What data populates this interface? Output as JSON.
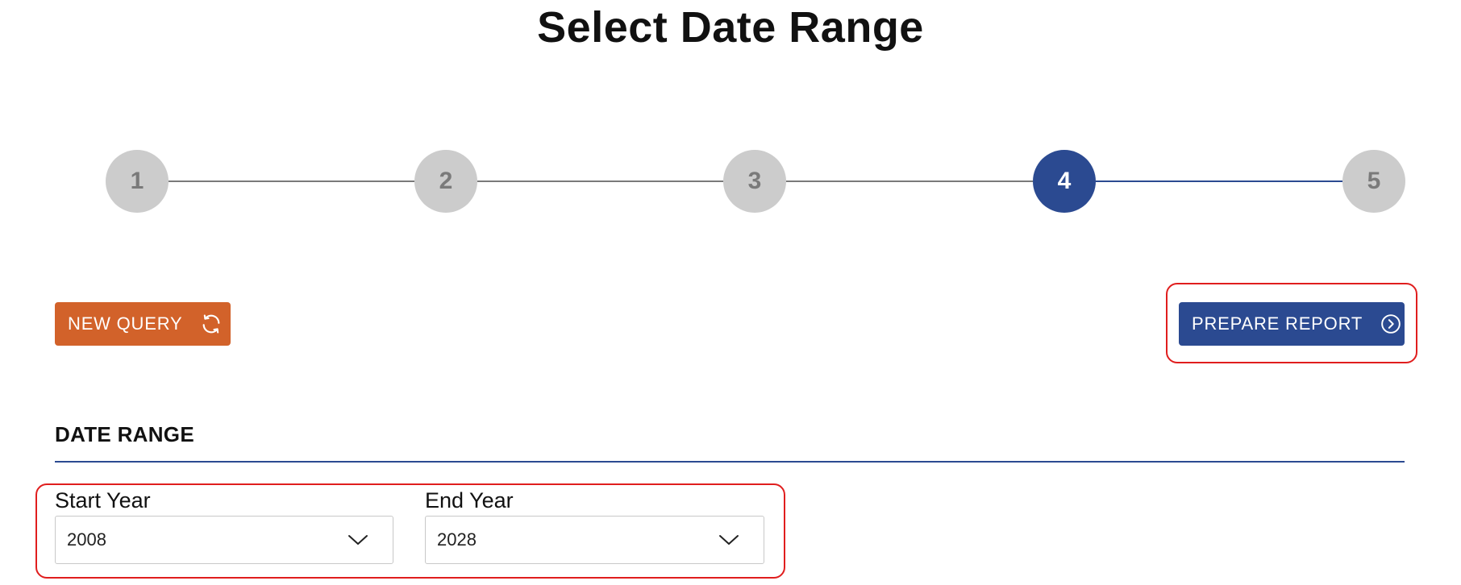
{
  "page": {
    "title": "Select Date Range"
  },
  "stepper": {
    "steps": [
      {
        "label": "1",
        "active": false
      },
      {
        "label": "2",
        "active": false
      },
      {
        "label": "3",
        "active": false
      },
      {
        "label": "4",
        "active": true
      },
      {
        "label": "5",
        "active": false
      }
    ]
  },
  "actions": {
    "new_query_label": "NEW QUERY",
    "new_query_icon": "refresh-icon",
    "prepare_report_label": "PREPARE REPORT",
    "prepare_report_icon": "chevron-right-circle-icon"
  },
  "date_range": {
    "section_title": "DATE RANGE",
    "start_year": {
      "label": "Start Year",
      "value": "2008"
    },
    "end_year": {
      "label": "End Year",
      "value": "2028"
    }
  },
  "colors": {
    "primary": "#2b4a91",
    "accent": "#d2622a",
    "step_inactive": "#cccccc",
    "highlight": "#e01e1e"
  }
}
